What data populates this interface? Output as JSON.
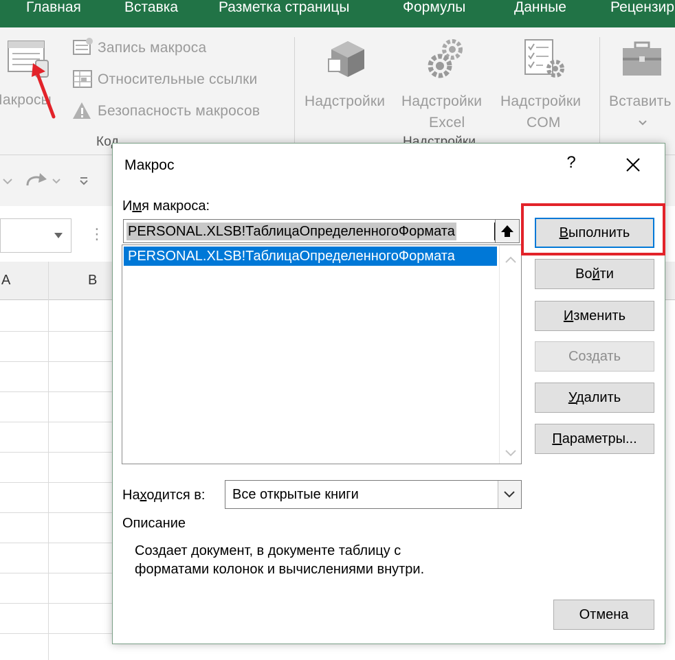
{
  "ribbon": {
    "tabs": [
      "Главная",
      "Вставка",
      "Разметка страницы",
      "Формулы",
      "Данные",
      "Рецензир"
    ],
    "macros_label": "Макросы",
    "code_items": [
      "Запись макроса",
      "Относительные ссылки",
      "Безопасность макросов"
    ],
    "group_code": "Код",
    "addins": {
      "label": "Надстройки"
    },
    "excel_addins": {
      "line1": "Надстройки",
      "line2": "Excel"
    },
    "com_addins": {
      "line1": "Надстройки",
      "line2": "COM"
    },
    "insert_label": "Вставить",
    "group_addins": "Надстройки"
  },
  "sheet": {
    "columns": [
      "A",
      "B"
    ]
  },
  "dialog": {
    "title": "Макрос",
    "help": "?",
    "name_label_parts": [
      "И",
      "м",
      "я макроса:"
    ],
    "name_value": "PERSONAL.XLSB!ТаблицаОпределенногоФормата",
    "macros": [
      "PERSONAL.XLSB!ТаблицаОпределенногоФормата"
    ],
    "buttons": {
      "run": {
        "pre": "",
        "acc": "В",
        "post": "ыполнить"
      },
      "step": {
        "pre": "Во",
        "acc": "й",
        "post": "ти"
      },
      "edit": {
        "pre": "",
        "acc": "И",
        "post": "зменить"
      },
      "create": {
        "pre": "",
        "acc": "",
        "post": "Создать"
      },
      "delete": {
        "pre": "",
        "acc": "У",
        "post": "далить"
      },
      "options": {
        "pre": "",
        "acc": "П",
        "post": "араметры..."
      },
      "cancel": {
        "pre": "",
        "acc": "",
        "post": "Отмена"
      }
    },
    "location_label_parts": [
      "На",
      "х",
      "одится в:"
    ],
    "location_value": "Все открытые книги",
    "description_label": "Описание",
    "description_lines": [
      "Создает документ, в документе таблицу с",
      "форматами колонок и вычислениями внутри."
    ]
  },
  "colors": {
    "ribbon_green": "#217346",
    "selection_blue": "#0078d7",
    "highlight_red": "#e2232a"
  }
}
